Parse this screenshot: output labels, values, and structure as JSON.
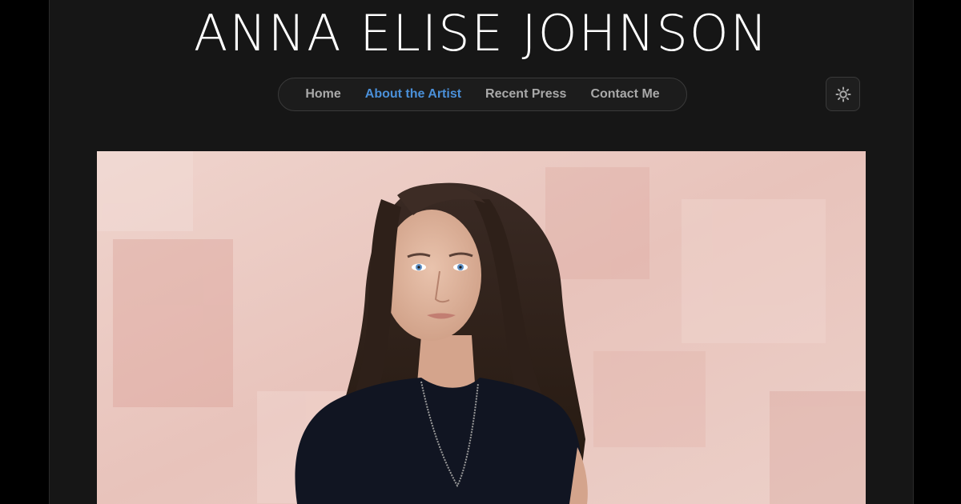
{
  "site": {
    "title": "ANNA ELISE JOHNSON"
  },
  "nav": {
    "items": [
      {
        "label": "Home",
        "active": false
      },
      {
        "label": "About the Artist",
        "active": true
      },
      {
        "label": "Recent Press",
        "active": false
      },
      {
        "label": "Contact Me",
        "active": false
      }
    ]
  },
  "theme_toggle": {
    "icon": "sun-icon"
  },
  "hero_photo": {
    "subject": "portrait photo"
  },
  "colors": {
    "background": "#161616",
    "outer": "#000000",
    "title": "#ffffff",
    "nav_text": "#a9a9a9",
    "nav_active": "#4a90d9",
    "wall": "#e9c7bf"
  }
}
